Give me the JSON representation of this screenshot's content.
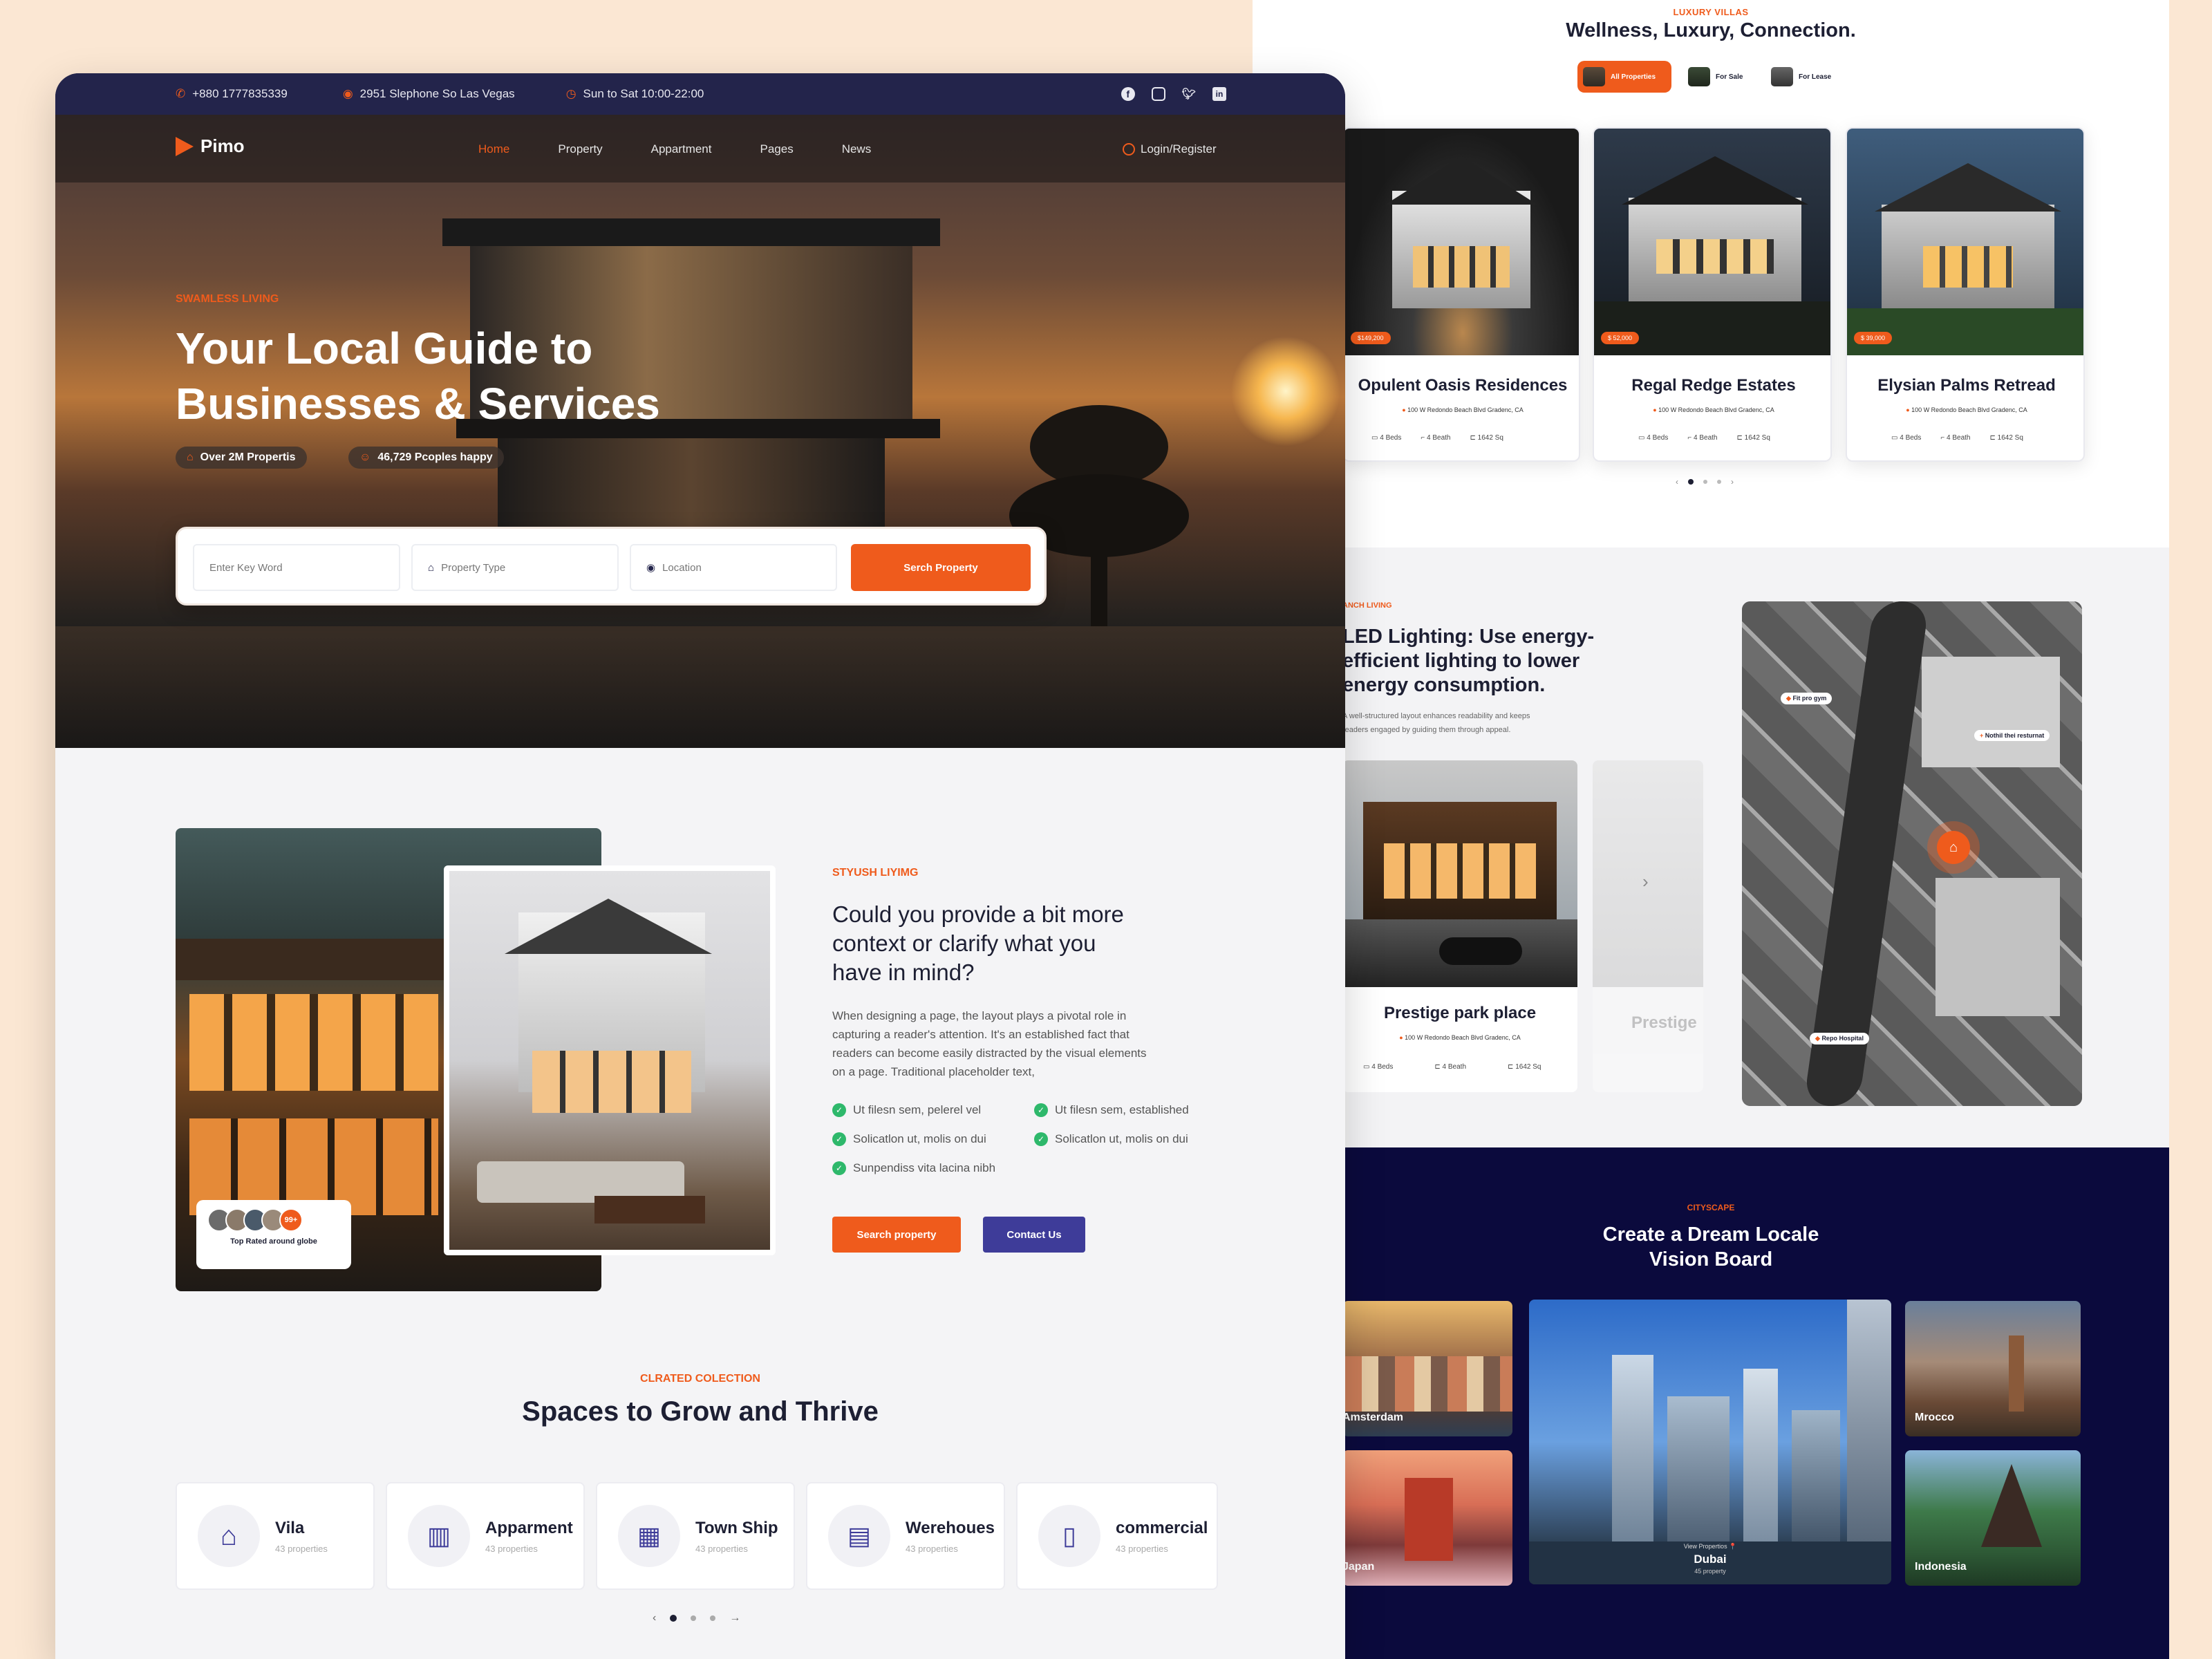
{
  "colors": {
    "accent": "#ef5b1c",
    "navy": "#23244b",
    "deep_navy": "#0b0a3d",
    "purple": "#3e3c99",
    "bg_peach": "#fbe7d3"
  },
  "topbar": {
    "phone": "+880 1777835339",
    "address": "2951 Slephone So Las Vegas",
    "hours": "Sun to Sat 10:00-22:00",
    "social_icons": [
      "facebook-icon",
      "instagram-icon",
      "twitter-icon",
      "linkedin-icon"
    ]
  },
  "nav": {
    "logo": "Pimo",
    "items": [
      "Home",
      "Property",
      "Appartment",
      "Pages",
      "News"
    ],
    "active": "Home",
    "login": "Login/Register"
  },
  "hero": {
    "eyebrow": "SWAMLESS LIVING",
    "title_line1": "Your Local Guide to",
    "title_line2": "Businesses & Services",
    "stat1": "Over 2M Propertis",
    "stat2": "46,729 Pcoples happy",
    "search": {
      "keyword_placeholder": "Enter Key Word",
      "type_placeholder": "Property Type",
      "location_placeholder": "Location",
      "button": "Serch Property"
    }
  },
  "about": {
    "eyebrow": "STYUSH LIYIMG",
    "title_line1": "Could you provide a bit more",
    "title_line2": "context or clarify what you",
    "title_line3": "have in mind?",
    "body_line1": "When designing a page, the layout plays a pivotal role in",
    "body_line2": "capturing a reader's attention. It's an established fact that",
    "body_line3": "readers can become easily distracted by the visual elements",
    "body_line4": "on a page. Traditional placeholder text,",
    "checks": [
      "Ut filesn sem, pelerel vel",
      "Ut filesn sem, established",
      "Solicatlon ut, molis on dui",
      "Solicatlon ut, molis on dui",
      "Sunpendiss vita lacina nibh"
    ],
    "btn_search": "Search property",
    "btn_contact": "Contact Us",
    "badge_count": "99+",
    "badge_text": "Top Rated around globe"
  },
  "collection": {
    "eyebrow": "CLRATED COLECTION",
    "title": "Spaces to Grow and Thrive",
    "items": [
      {
        "name": "Vila",
        "sub": "43 properties",
        "icon": "villa-icon"
      },
      {
        "name": "Apparment",
        "sub": "43 properties",
        "icon": "apartment-icon"
      },
      {
        "name": "Town Ship",
        "sub": "43 properties",
        "icon": "township-icon"
      },
      {
        "name": "Werehoues",
        "sub": "43 properties",
        "icon": "warehouse-icon"
      },
      {
        "name": "commercial",
        "sub": "43 properties",
        "icon": "commercial-icon"
      }
    ]
  },
  "luxury": {
    "eyebrow": "LUXURY VILLAS",
    "title": "Wellness, Luxury, Connection.",
    "tabs": [
      "All Properties",
      "For Sale",
      "For Lease"
    ],
    "cards": [
      {
        "price": "$149,200",
        "name": "Opulent Oasis Residences",
        "address": "100 W Redondo Beach Blvd Gradenc, CA",
        "beds": "4 Beds",
        "baths": "4 Beath",
        "area": "1642 Sq"
      },
      {
        "price": "$ 52,000",
        "name": "Regal Redge Estates",
        "address": "100 W Redondo Beach Blvd Gradenc, CA",
        "beds": "4 Beds",
        "baths": "4 Beath",
        "area": "1642 Sq"
      },
      {
        "price": "$ 39,000",
        "name": "Elysian Palms Retread",
        "address": "100 W Redondo Beach Blvd Gradenc, CA",
        "beds": "4 Beds",
        "baths": "4 Beath",
        "area": "1642 Sq"
      }
    ]
  },
  "led": {
    "eyebrow": "ANCH LIVING",
    "title_line1": "LED Lighting: Use energy-",
    "title_line2": "efficient lighting to lower",
    "title_line3": "energy consumption.",
    "body_line1": "A well-structured layout enhances readability and keeps",
    "body_line2": "readers engaged by guiding them through appeal.",
    "card": {
      "name": "Prestige park place",
      "address": "100 W Redondo Beach Blvd Gradenc, CA",
      "beds": "4 Beds",
      "baths": "4 Beath",
      "area": "1642 Sq"
    },
    "ghost_name": "Prestige",
    "map_pins": [
      "Fit pro gym",
      "Nothil thei resturnat",
      "Repo Hospital"
    ]
  },
  "cityscape": {
    "eyebrow": "CITYSCAPE",
    "title_line1": "Create a Dream Locale",
    "title_line2": "Vision Board",
    "cities": [
      "Amsterdam",
      "Japan",
      "Dubai",
      "Mrocco",
      "Indonesia"
    ],
    "dubai_sub1": "View Propertios 📍",
    "dubai_sub2": "45 property"
  }
}
